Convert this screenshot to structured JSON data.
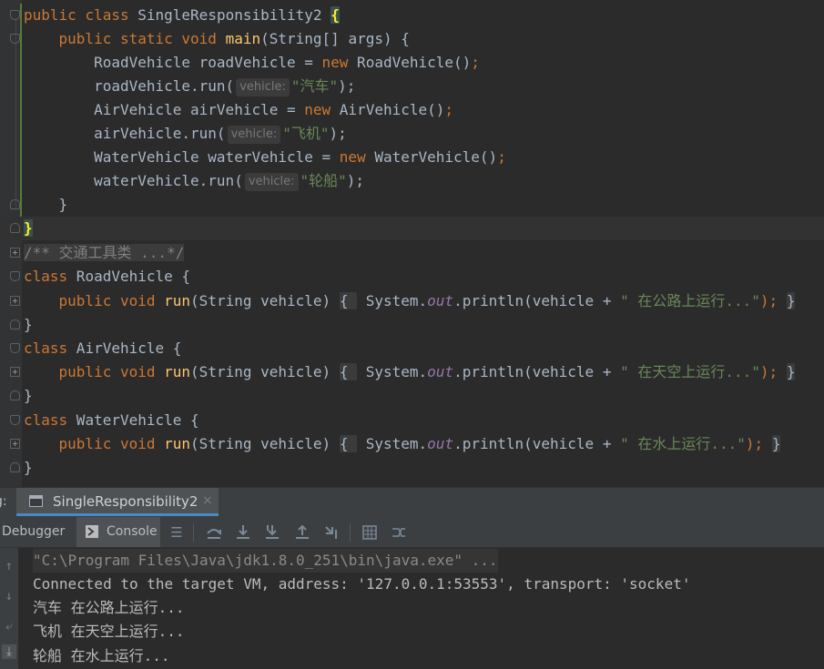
{
  "editor": {
    "lines": {
      "l1": {
        "kw1": "public",
        "kw2": "class",
        "name": "SingleResponsibility2",
        "brace": "{"
      },
      "l2": {
        "kw1": "public",
        "kw2": "static",
        "kw3": "void",
        "fn": "main",
        "rest": "(String[] args) {"
      },
      "l3": {
        "a": "RoadVehicle roadVehicle = ",
        "kw": "new",
        "b": " RoadVehicle()",
        ";": ";"
      },
      "l4": {
        "a": "roadVehicle.run(",
        "hint": "vehicle:",
        "str": "\"汽车\"",
        "b": ");"
      },
      "l5": {
        "a": "AirVehicle airVehicle = ",
        "kw": "new",
        "b": " AirVehicle()",
        ";": ";"
      },
      "l6": {
        "a": "airVehicle.run(",
        "hint": "vehicle:",
        "str": "\"飞机\"",
        "b": ");"
      },
      "l7": {
        "a": "WaterVehicle waterVehicle = ",
        "kw": "new",
        "b": " WaterVehicle()",
        ";": ";"
      },
      "l8": {
        "a": "waterVehicle.run(",
        "hint": "vehicle:",
        "str": "\"轮船\"",
        "b": ");"
      },
      "l9": {
        "a": "}"
      },
      "l10": {
        "a": "}"
      },
      "l11": {
        "cmt": "/** 交通工具类 ...*/"
      },
      "l12": {
        "kw": "class",
        "b": " RoadVehicle {"
      },
      "l13": {
        "kw1": "public",
        "kw2": "void",
        "fn": "run",
        "a": "(String vehicle) ",
        "b1": "{",
        "c": " System.",
        "fld": "out",
        "d": ".println(vehicle + ",
        "str": "\" 在公路上运行...\"",
        "e": ");",
        "b2": "}"
      },
      "l14": {
        "a": "}"
      },
      "l15": {
        "kw": "class",
        "b": " AirVehicle {"
      },
      "l16": {
        "kw1": "public",
        "kw2": "void",
        "fn": "run",
        "a": "(String vehicle) ",
        "b1": "{",
        "c": " System.",
        "fld": "out",
        "d": ".println(vehicle + ",
        "str": "\" 在天空上运行...\"",
        "e": ");",
        "b2": "}"
      },
      "l17": {
        "a": "}"
      },
      "l18": {
        "kw": "class",
        "b": " WaterVehicle {"
      },
      "l19": {
        "kw1": "public",
        "kw2": "void",
        "fn": "run",
        "a": "(String vehicle) ",
        "b1": "{",
        "c": " System.",
        "fld": "out",
        "d": ".println(vehicle + ",
        "str": "\" 在水上运行...\"",
        "e": ");",
        "b2": "}"
      },
      "l20": {
        "a": "}"
      }
    }
  },
  "runbar": {
    "label": "g:",
    "tab_title": "SingleResponsibility2",
    "close": "×"
  },
  "toolbar": {
    "debugger": "Debugger",
    "console": "Console"
  },
  "console": {
    "lines": [
      "\"C:\\Program Files\\Java\\jdk1.8.0_251\\bin\\java.exe\" ...",
      "Connected to the target VM, address: '127.0.0.1:53553', transport: 'socket'",
      "汽车 在公路上运行...",
      "飞机 在天空上运行...",
      "轮船 在水上运行..."
    ]
  },
  "icons": {
    "console_tab": "console-icon",
    "toolbar": [
      "menu-icon",
      "step-over-icon",
      "step-into-icon",
      "force-step-into-icon",
      "step-out-icon",
      "run-to-cursor-icon",
      "evaluate-icon",
      "trace-icon"
    ],
    "side": [
      "up-icon",
      "down-icon",
      "soft-wrap-icon",
      "scroll-to-end-icon"
    ]
  }
}
